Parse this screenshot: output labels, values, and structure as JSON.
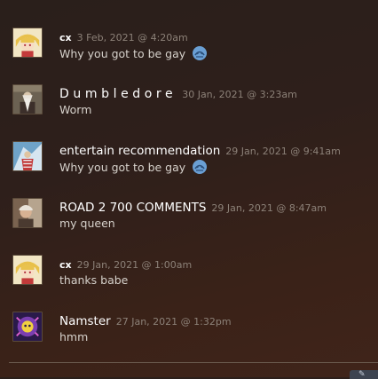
{
  "comments": [
    {
      "author": "cx",
      "timestamp": "3 Feb, 2021 @ 4:20am",
      "text": "Why you got to be gay",
      "emoticon": "blue-steam-emoticon"
    },
    {
      "author": "Dumbledore",
      "timestamp": "30 Jan, 2021 @ 3:23am",
      "text": "Worm"
    },
    {
      "author": "entertain recommendation",
      "timestamp": "29 Jan, 2021 @ 9:41am",
      "text": "Why you got to be gay",
      "emoticon": "blue-steam-emoticon"
    },
    {
      "author": "ROAD 2 700 COMMENTS",
      "timestamp": "29 Jan, 2021 @ 8:47am",
      "text": "my queen"
    },
    {
      "author": "cx",
      "timestamp": "29 Jan, 2021 @ 1:00am",
      "text": "thanks babe"
    },
    {
      "author": "Namster",
      "timestamp": "27 Jan, 2021 @ 1:32pm",
      "text": "hmm"
    }
  ],
  "corner_button": {
    "icon": "pencil-icon",
    "label": "✎"
  },
  "colors": {
    "author": "#ffffff",
    "timestamp": "#8c8178",
    "body_text": "#d6d1cb",
    "emoticon": "#6a9fd4",
    "background": "#2e1f1b"
  }
}
